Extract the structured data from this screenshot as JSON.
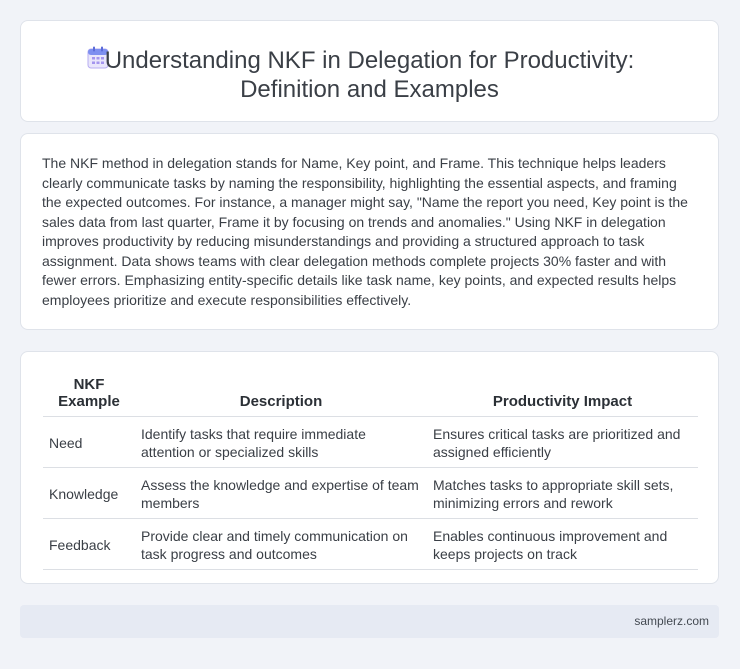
{
  "header": {
    "icon": "calendar-icon",
    "title_line1": "Understanding NKF in Delegation for Productivity:",
    "title_line2": "Definition and Examples"
  },
  "summary": {
    "text": "The NKF method in delegation stands for Name, Key point, and Frame. This technique helps leaders clearly communicate tasks by naming the responsibility, highlighting the essential aspects, and framing the expected outcomes. For instance, a manager might say, \"Name the report you need, Key point is the sales data from last quarter, Frame it by focusing on trends and anomalies.\" Using NKF in delegation improves productivity by reducing misunderstandings and providing a structured approach to task assignment. Data shows teams with clear delegation methods complete projects 30% faster and with fewer errors. Emphasizing entity-specific details like task name, key points, and expected results helps employees prioritize and execute responsibilities effectively."
  },
  "table": {
    "headers": {
      "example": "NKF Example",
      "description": "Description",
      "impact": "Productivity Impact"
    },
    "rows": [
      {
        "example": "Need",
        "description": "Identify tasks that require immediate attention or specialized skills",
        "impact": "Ensures critical tasks are prioritized and assigned efficiently"
      },
      {
        "example": "Knowledge",
        "description": "Assess the knowledge and expertise of team members",
        "impact": "Matches tasks to appropriate skill sets, minimizing errors and rework"
      },
      {
        "example": "Feedback",
        "description": "Provide clear and timely communication on task progress and outcomes",
        "impact": "Enables continuous improvement and keeps projects on track"
      }
    ]
  },
  "footer": {
    "site": "samplerz.com"
  },
  "colors": {
    "background": "#f1f3f8",
    "card": "#ffffff",
    "footer": "#e6eaf3",
    "icon_accent": "#8a7be8"
  }
}
